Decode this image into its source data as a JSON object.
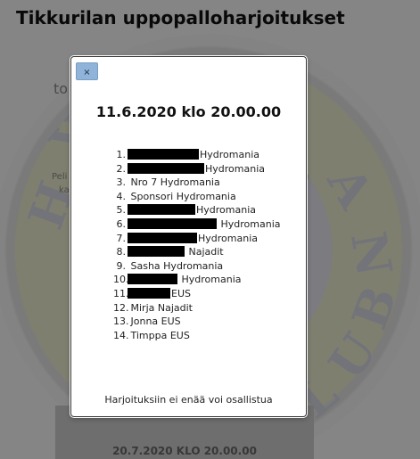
{
  "page": {
    "title": "Tikkurilan uppopalloharjoitukset",
    "bg_texts": [
      "to",
      "Peli",
      "ka",
      "n",
      "u"
    ],
    "bg_card_date": "20.7.2020 KLO 20.00.00",
    "logo_letters": [
      "H",
      "Y",
      "D",
      "R",
      "O",
      "M",
      "A",
      "N",
      "I",
      "A",
      "C",
      "L",
      "U",
      "B"
    ]
  },
  "modal": {
    "close_label": "×",
    "date": "11.6.2020 klo 20.00.00",
    "participants": [
      {
        "num": "1.",
        "name": "Hydromania",
        "redacted": true
      },
      {
        "num": "2.",
        "name": "Hydromania",
        "redacted": true
      },
      {
        "num": "3.",
        "name": "Nro 7 Hydromania",
        "redacted": false
      },
      {
        "num": "4.",
        "name": "Sponsori Hydromania",
        "redacted": false
      },
      {
        "num": "5.",
        "name": "Hydromania",
        "redacted": true
      },
      {
        "num": "6.",
        "name": "Hydromania",
        "redacted": true
      },
      {
        "num": "7.",
        "name": "Hydromania",
        "redacted": true
      },
      {
        "num": "8.",
        "name": "Najadit",
        "redacted": true
      },
      {
        "num": "9.",
        "name": "Sasha Hydromania",
        "redacted": false
      },
      {
        "num": "10.",
        "name": "Hydromania",
        "redacted": true
      },
      {
        "num": "11.",
        "name": "EUS",
        "redacted": true
      },
      {
        "num": "12.",
        "name": "Mirja Najadit",
        "redacted": false
      },
      {
        "num": "13.",
        "name": "Jonna EUS",
        "redacted": false
      },
      {
        "num": "14.",
        "name": "Timppa EUS",
        "redacted": false
      }
    ],
    "footer": "Harjoituksiin ei enää voi osallistua"
  },
  "colors": {
    "close_button": "#8fb3d9",
    "redaction": "#000000",
    "overlay": "rgba(0,0,0,0.45)"
  }
}
